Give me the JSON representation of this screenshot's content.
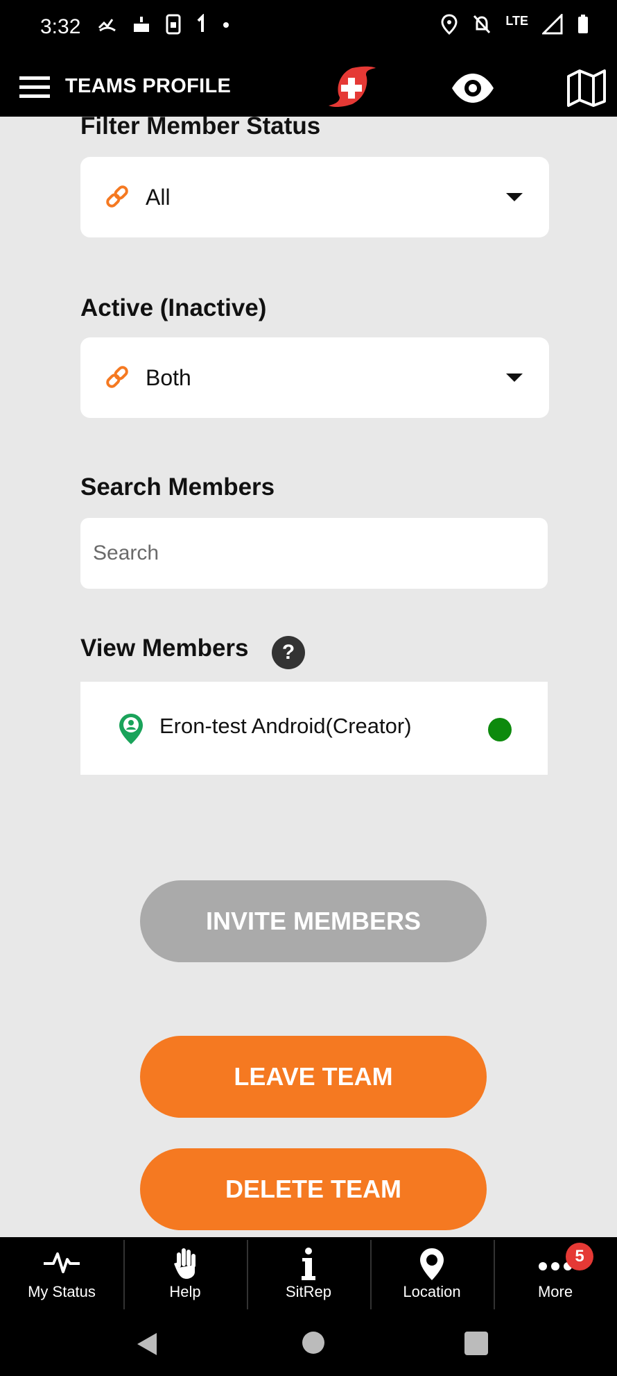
{
  "status_bar": {
    "time": "3:32",
    "network": "LTE"
  },
  "app_bar": {
    "title": "TEAMS PROFILE",
    "menu_icon": "hamburger-menu-icon",
    "logo_icon": "hurricane-plus-logo",
    "eye_icon": "eye-icon",
    "map_icon": "map-icon"
  },
  "filters": {
    "member_status": {
      "label": "Filter Member Status",
      "value": "All"
    },
    "active": {
      "label": "Active (Inactive)",
      "value": "Both"
    }
  },
  "search": {
    "label": "Search Members",
    "placeholder": "Search"
  },
  "view_members": {
    "label": "View Members",
    "help_glyph": "?",
    "members": [
      {
        "name": "Eron-test Android(Creator)",
        "status_color": "#0d8a0d"
      }
    ]
  },
  "buttons": {
    "invite": "INVITE MEMBERS",
    "leave": "LEAVE TEAM",
    "delete": "DELETE TEAM"
  },
  "bottom_nav": {
    "items": [
      {
        "label": "My Status",
        "icon": "heartbeat-icon"
      },
      {
        "label": "Help",
        "icon": "hand-icon"
      },
      {
        "label": "SitRep",
        "icon": "info-icon"
      },
      {
        "label": "Location",
        "icon": "location-pin-icon"
      },
      {
        "label": "More",
        "icon": "more-dots-icon",
        "badge": "5"
      }
    ]
  },
  "colors": {
    "accent": "#f57921",
    "disabled": "#aaaaaa",
    "background": "#e8e8e8",
    "online": "#0d8a0d"
  }
}
